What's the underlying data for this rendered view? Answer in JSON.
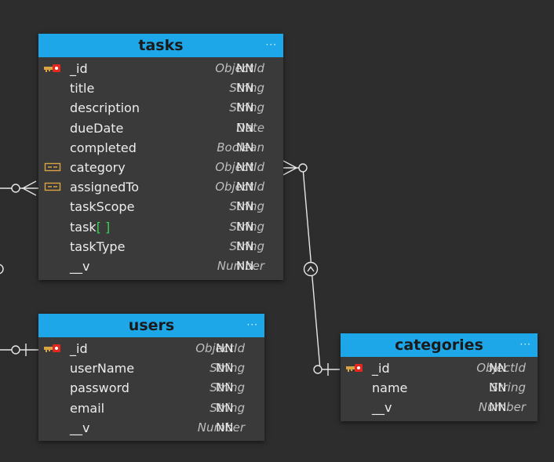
{
  "entities": {
    "tasks": {
      "title": "tasks",
      "menu": "···",
      "fields": [
        {
          "name": "_id",
          "type": "ObjectId",
          "constraint": "NN",
          "icon": "primary-key-icon"
        },
        {
          "name": "title",
          "type": "String",
          "constraint": "NN",
          "icon": ""
        },
        {
          "name": "description",
          "type": "String",
          "constraint": "NN",
          "icon": ""
        },
        {
          "name": "dueDate",
          "type": "Date",
          "constraint": "NN",
          "icon": ""
        },
        {
          "name": "completed",
          "type": "Boolean",
          "constraint": "NN",
          "icon": ""
        },
        {
          "name": "category",
          "type": "ObjectId",
          "constraint": "NN",
          "icon": "foreign-key-icon"
        },
        {
          "name": "assignedTo",
          "type": "ObjectId",
          "constraint": "NN",
          "icon": "foreign-key-icon"
        },
        {
          "name": "taskScope",
          "type": "String",
          "constraint": "NN",
          "icon": ""
        },
        {
          "name": "task",
          "array_marker": "[ ]",
          "type": "String",
          "constraint": "NN",
          "icon": ""
        },
        {
          "name": "taskType",
          "type": "String",
          "constraint": "NN",
          "icon": ""
        },
        {
          "name": "__v",
          "type": "Number",
          "constraint": "NN",
          "icon": ""
        }
      ]
    },
    "users": {
      "title": "users",
      "menu": "···",
      "fields": [
        {
          "name": "_id",
          "type": "ObjectId",
          "constraint": "NN",
          "icon": "primary-key-icon"
        },
        {
          "name": "userName",
          "type": "String",
          "constraint": "NN",
          "icon": ""
        },
        {
          "name": "password",
          "type": "String",
          "constraint": "NN",
          "icon": ""
        },
        {
          "name": "email",
          "type": "String",
          "constraint": "NN",
          "icon": ""
        },
        {
          "name": "__v",
          "type": "Number",
          "constraint": "NN",
          "icon": ""
        }
      ]
    },
    "categories": {
      "title": "categories",
      "menu": "···",
      "fields": [
        {
          "name": "_id",
          "type": "ObjectId",
          "constraint": "NN",
          "icon": "primary-key-icon"
        },
        {
          "name": "name",
          "type": "String",
          "constraint": "NN",
          "icon": ""
        },
        {
          "name": "__v",
          "type": "Number",
          "constraint": "NN",
          "icon": ""
        }
      ]
    }
  },
  "relationships": [
    {
      "from": "tasks.category",
      "to": "categories._id",
      "from_end": "zero-or-many",
      "to_end": "zero-or-one"
    },
    {
      "from": "tasks.assignedTo",
      "to": "users._id",
      "from_end": "zero-or-many",
      "to_end": "zero-or-one"
    }
  ],
  "colors": {
    "canvas": "#2d2d2d",
    "header": "#1ea7e8",
    "body": "#3a3a3a",
    "link": "#e6e6e6",
    "array_marker": "#39d353",
    "foreign_key": "#d9a441"
  }
}
